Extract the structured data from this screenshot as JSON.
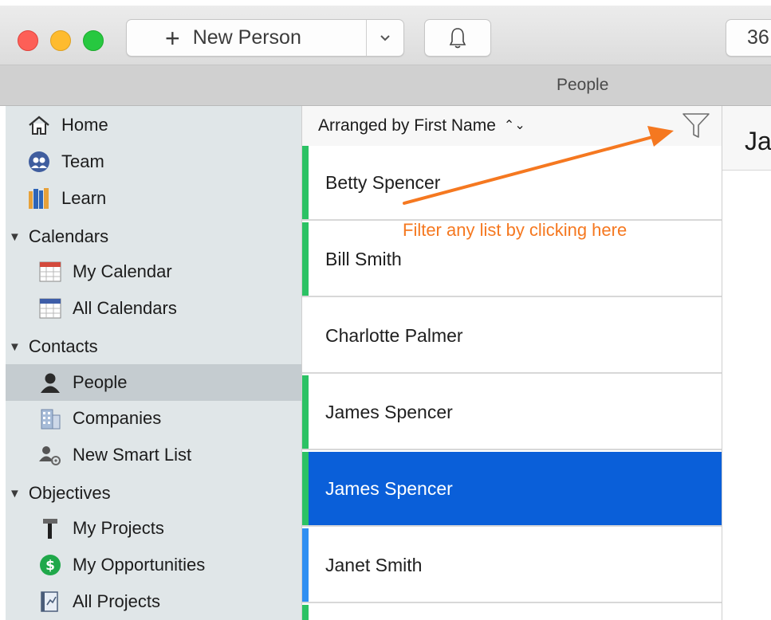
{
  "toolbar": {
    "new_person_label": "New Person",
    "search_value": "36"
  },
  "window": {
    "title": "People"
  },
  "sidebar": {
    "top": [
      {
        "label": "Home",
        "icon": "home-icon"
      },
      {
        "label": "Team",
        "icon": "team-icon"
      },
      {
        "label": "Learn",
        "icon": "books-icon"
      }
    ],
    "calendars": {
      "heading": "Calendars",
      "items": [
        {
          "label": "My Calendar",
          "icon": "calendar-icon"
        },
        {
          "label": "All Calendars",
          "icon": "calendars-icon"
        }
      ]
    },
    "contacts": {
      "heading": "Contacts",
      "items": [
        {
          "label": "People",
          "icon": "person-icon"
        },
        {
          "label": "Companies",
          "icon": "building-icon"
        },
        {
          "label": "New Smart List",
          "icon": "smart-list-icon"
        }
      ]
    },
    "objectives": {
      "heading": "Objectives",
      "items": [
        {
          "label": "My Projects",
          "icon": "hammer-icon"
        },
        {
          "label": "My Opportunities",
          "icon": "dollar-icon"
        },
        {
          "label": "All Projects",
          "icon": "projects-icon"
        }
      ]
    }
  },
  "list": {
    "sort_label": "Arranged by First Name",
    "rows": [
      {
        "name": "Betty Spencer",
        "stripe": "#2cc264"
      },
      {
        "name": "Bill Smith",
        "stripe": "#2cc264"
      },
      {
        "name": "Charlotte Palmer",
        "stripe": ""
      },
      {
        "name": "James Spencer",
        "stripe": "#2cc264"
      },
      {
        "name": "James Spencer",
        "stripe": "#2cc264",
        "selected": true
      },
      {
        "name": "Janet Smith",
        "stripe": "#2f8ff2"
      }
    ]
  },
  "detail": {
    "name_partial": "Ja"
  },
  "annotation": {
    "text": "Filter any list by clicking here",
    "color": "#f57820"
  },
  "colors": {
    "selection": "#0a5fd9",
    "sidebar_bg": "#e0e6e8",
    "sidebar_selected": "#c5ccd0"
  }
}
